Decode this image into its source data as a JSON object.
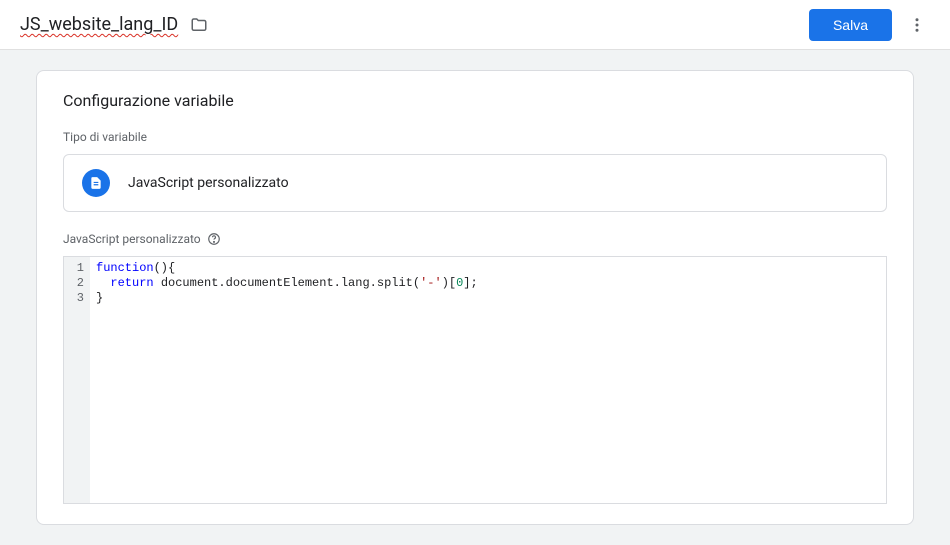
{
  "header": {
    "title": "JS_website_lang_ID",
    "save_label": "Salva"
  },
  "panel": {
    "heading": "Configurazione variabile",
    "type_label": "Tipo di variabile",
    "type_value": "JavaScript personalizzato",
    "editor_label": "JavaScript personalizzato",
    "code_lines": [
      "function(){",
      "  return document.documentElement.lang.split('-')[0];",
      "}"
    ]
  }
}
